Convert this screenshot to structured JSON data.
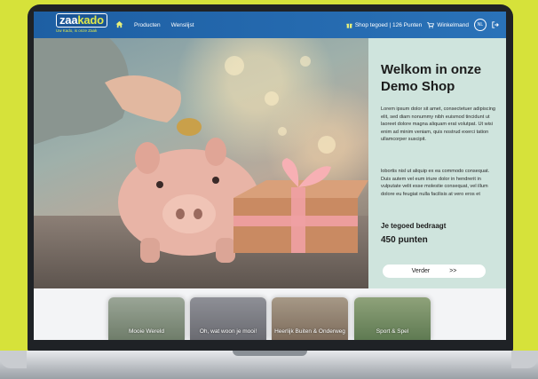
{
  "logo": {
    "name_part1": "zaa",
    "name_part2": "kado",
    "tagline": "Uw Kado, is onze Zaak"
  },
  "nav": {
    "home_icon": "home-icon",
    "links": [
      "Producten",
      "Wenslijst"
    ],
    "tegoed": "Shop tegoed | 126 Punten",
    "cart": "Winkelmand",
    "language": "NL",
    "logout_icon": "logout-icon"
  },
  "hero": {
    "title": "Welkom in onze Demo Shop",
    "paragraph1": "Lorem ipsum dolor sit amet, consectetuer adipiscing elit, sed diam nonummy nibh euismod tincidunt ut laoreet dolore magna aliquam erat volutpat. Ut wisi enim ad minim veniam, quis nostrud exerci tation ullamcorper suscipit.",
    "paragraph2": "lobortis nisl ut aliquip ex ea commodo consequat. Duis autem vel eum iriure dolor in hendrerit in vulputate velit esse molestie consequat, vel illum dolore eu feugiat nulla facilisis at vero eros et",
    "balance_label": "Je tegoed bedraagt",
    "balance_value": "450 punten",
    "button_label": "Verder",
    "button_arrow": ">>"
  },
  "categories": [
    "Mooie Wereld",
    "Oh, wat woon je mooi!",
    "Heerlijk Buiten & Onderweg",
    "Sport & Spel"
  ],
  "colors": {
    "navbar": "#2a72b8",
    "panel": "#cfe4dd",
    "background": "#d6e23a"
  }
}
